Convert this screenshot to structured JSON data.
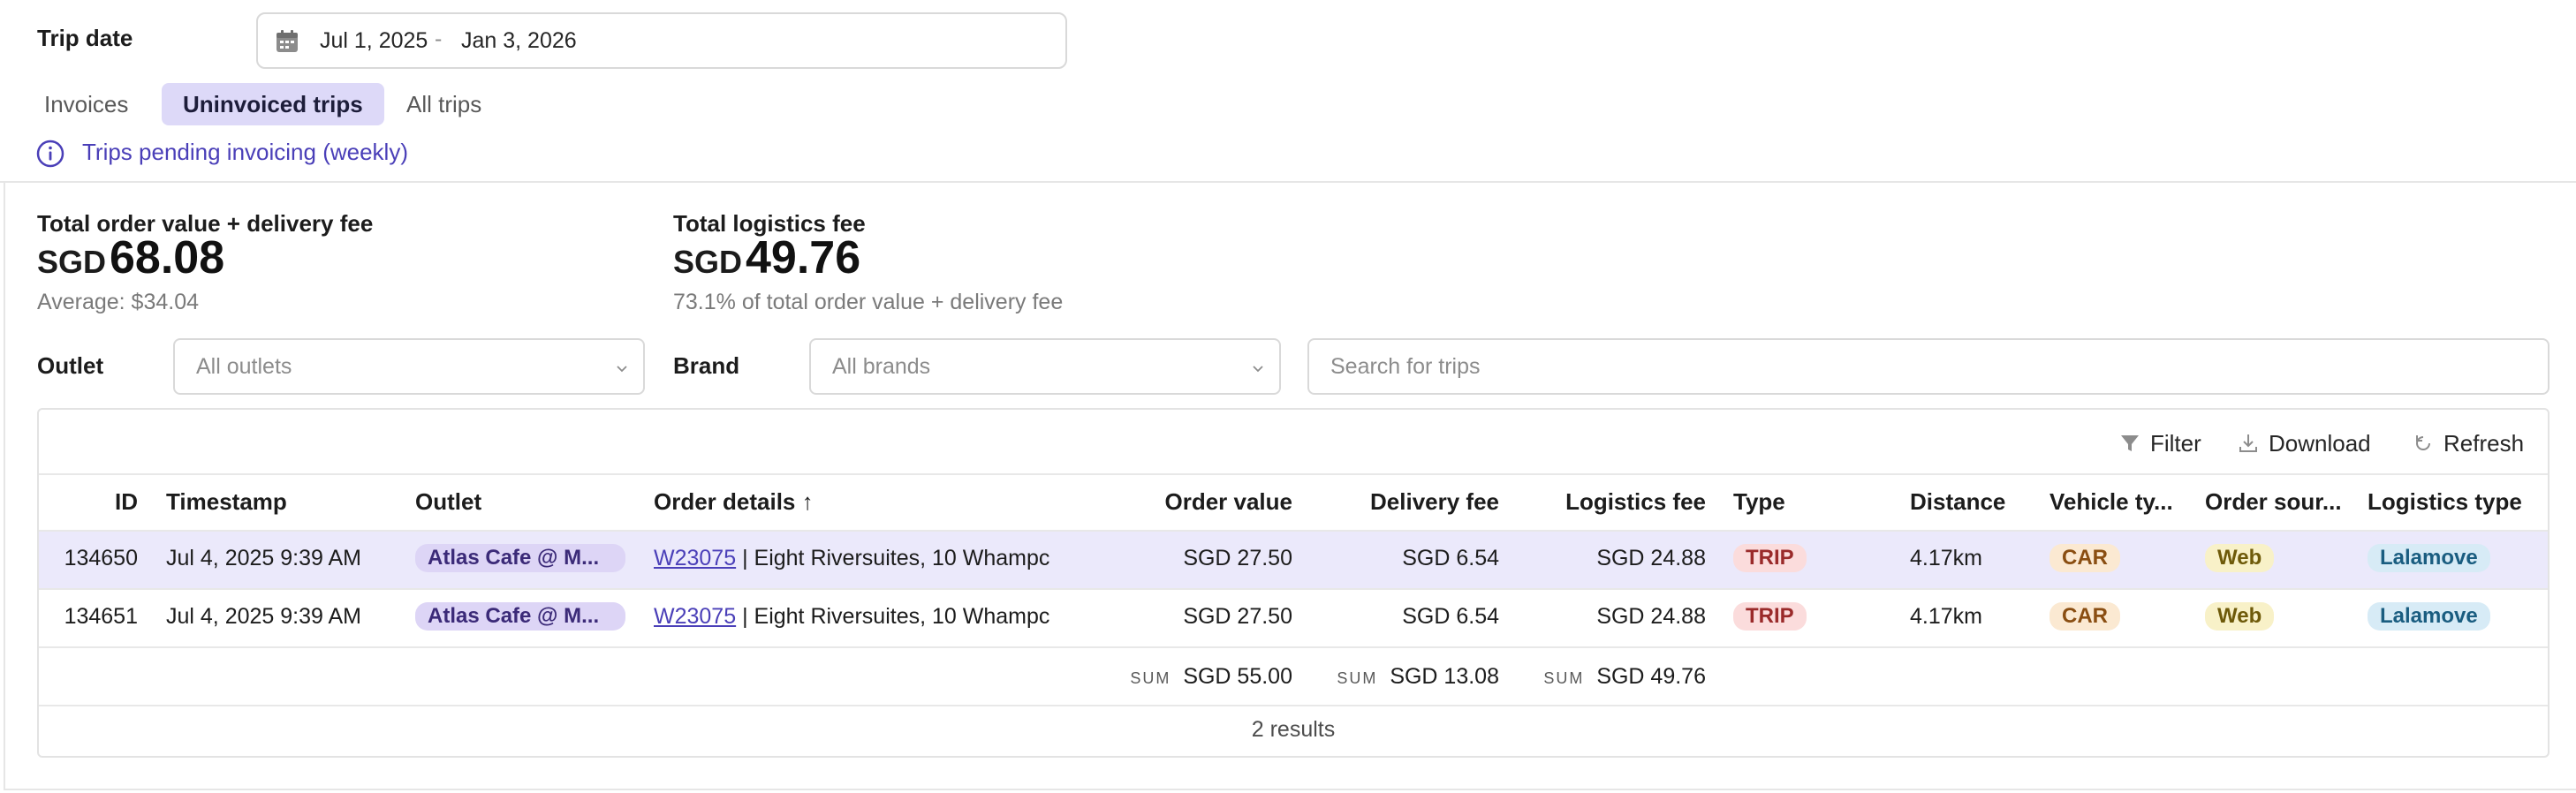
{
  "trip_date": {
    "label": "Trip date",
    "start": "Jul 1, 2025",
    "separator": "-",
    "end": "Jan 3, 2026"
  },
  "tabs": [
    {
      "label": "Invoices",
      "active": false
    },
    {
      "label": "Uninvoiced trips",
      "active": true
    },
    {
      "label": "All trips",
      "active": false
    }
  ],
  "info": {
    "text": "Trips pending invoicing (weekly)"
  },
  "stats": [
    {
      "label": "Total order value + delivery fee",
      "currency": "SGD",
      "amount": "68.08",
      "sub": "Average: $34.04"
    },
    {
      "label": "Total logistics fee",
      "currency": "SGD",
      "amount": "49.76",
      "sub": "73.1% of total order value + delivery fee"
    }
  ],
  "filters": {
    "outlet_label": "Outlet",
    "outlet_placeholder": "All outlets",
    "brand_label": "Brand",
    "brand_placeholder": "All brands",
    "search_placeholder": "Search for trips"
  },
  "toolbar": {
    "filter": "Filter",
    "download": "Download",
    "refresh": "Refresh"
  },
  "table": {
    "columns": {
      "id": "ID",
      "timestamp": "Timestamp",
      "outlet": "Outlet",
      "order_details": "Order details",
      "sort_indicator": "↑",
      "order_value": "Order value",
      "delivery_fee": "Delivery fee",
      "logistics_fee": "Logistics fee",
      "type": "Type",
      "distance": "Distance",
      "vehicle_type": "Vehicle ty...",
      "order_source": "Order sour...",
      "logistics_type": "Logistics type"
    },
    "rows": [
      {
        "id": "134650",
        "timestamp": "Jul 4, 2025 9:39 AM",
        "outlet": "Atlas Cafe @ M...",
        "order_code": "W23075",
        "order_addr": "| Eight Riversuites, 10 Whampc",
        "order_value": "SGD 27.50",
        "delivery_fee": "SGD 6.54",
        "logistics_fee": "SGD 24.88",
        "type": "TRIP",
        "distance": "4.17km",
        "vehicle": "CAR",
        "source": "Web",
        "logistics_type": "Lalamove"
      },
      {
        "id": "134651",
        "timestamp": "Jul 4, 2025 9:39 AM",
        "outlet": "Atlas Cafe @ M...",
        "order_code": "W23075",
        "order_addr": "| Eight Riversuites, 10 Whampc",
        "order_value": "SGD 27.50",
        "delivery_fee": "SGD 6.54",
        "logistics_fee": "SGD 24.88",
        "type": "TRIP",
        "distance": "4.17km",
        "vehicle": "CAR",
        "source": "Web",
        "logistics_type": "Lalamove"
      }
    ],
    "sums": {
      "caption": "SUM",
      "order_value": "SGD 55.00",
      "delivery_fee": "SGD 13.08",
      "logistics_fee": "SGD 49.76"
    },
    "results": "2 results"
  }
}
